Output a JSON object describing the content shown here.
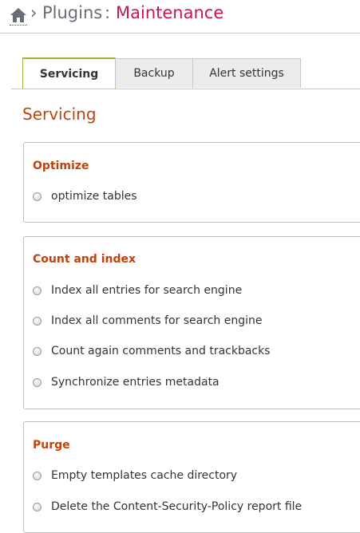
{
  "breadcrumb": {
    "home_icon": "home-icon",
    "separator": "›",
    "parent": "Plugins",
    "colon": ":",
    "current": "Maintenance"
  },
  "colors": {
    "accent_title": "#c2185b",
    "section_heading": "#c2410c",
    "active_tab_border": "#9cb83c"
  },
  "tabs": [
    {
      "label": "Servicing",
      "active": true
    },
    {
      "label": "Backup",
      "active": false
    },
    {
      "label": "Alert settings",
      "active": false
    }
  ],
  "section_title": "Servicing",
  "groups": [
    {
      "title": "Optimize",
      "options": [
        "optimize tables"
      ]
    },
    {
      "title": "Count and index",
      "options": [
        "Index all entries for search engine",
        "Index all comments for search engine",
        "Count again comments and trackbacks",
        "Synchronize entries metadata"
      ]
    },
    {
      "title": "Purge",
      "options": [
        "Empty templates cache directory",
        "Delete the Content-Security-Policy report file"
      ]
    }
  ]
}
